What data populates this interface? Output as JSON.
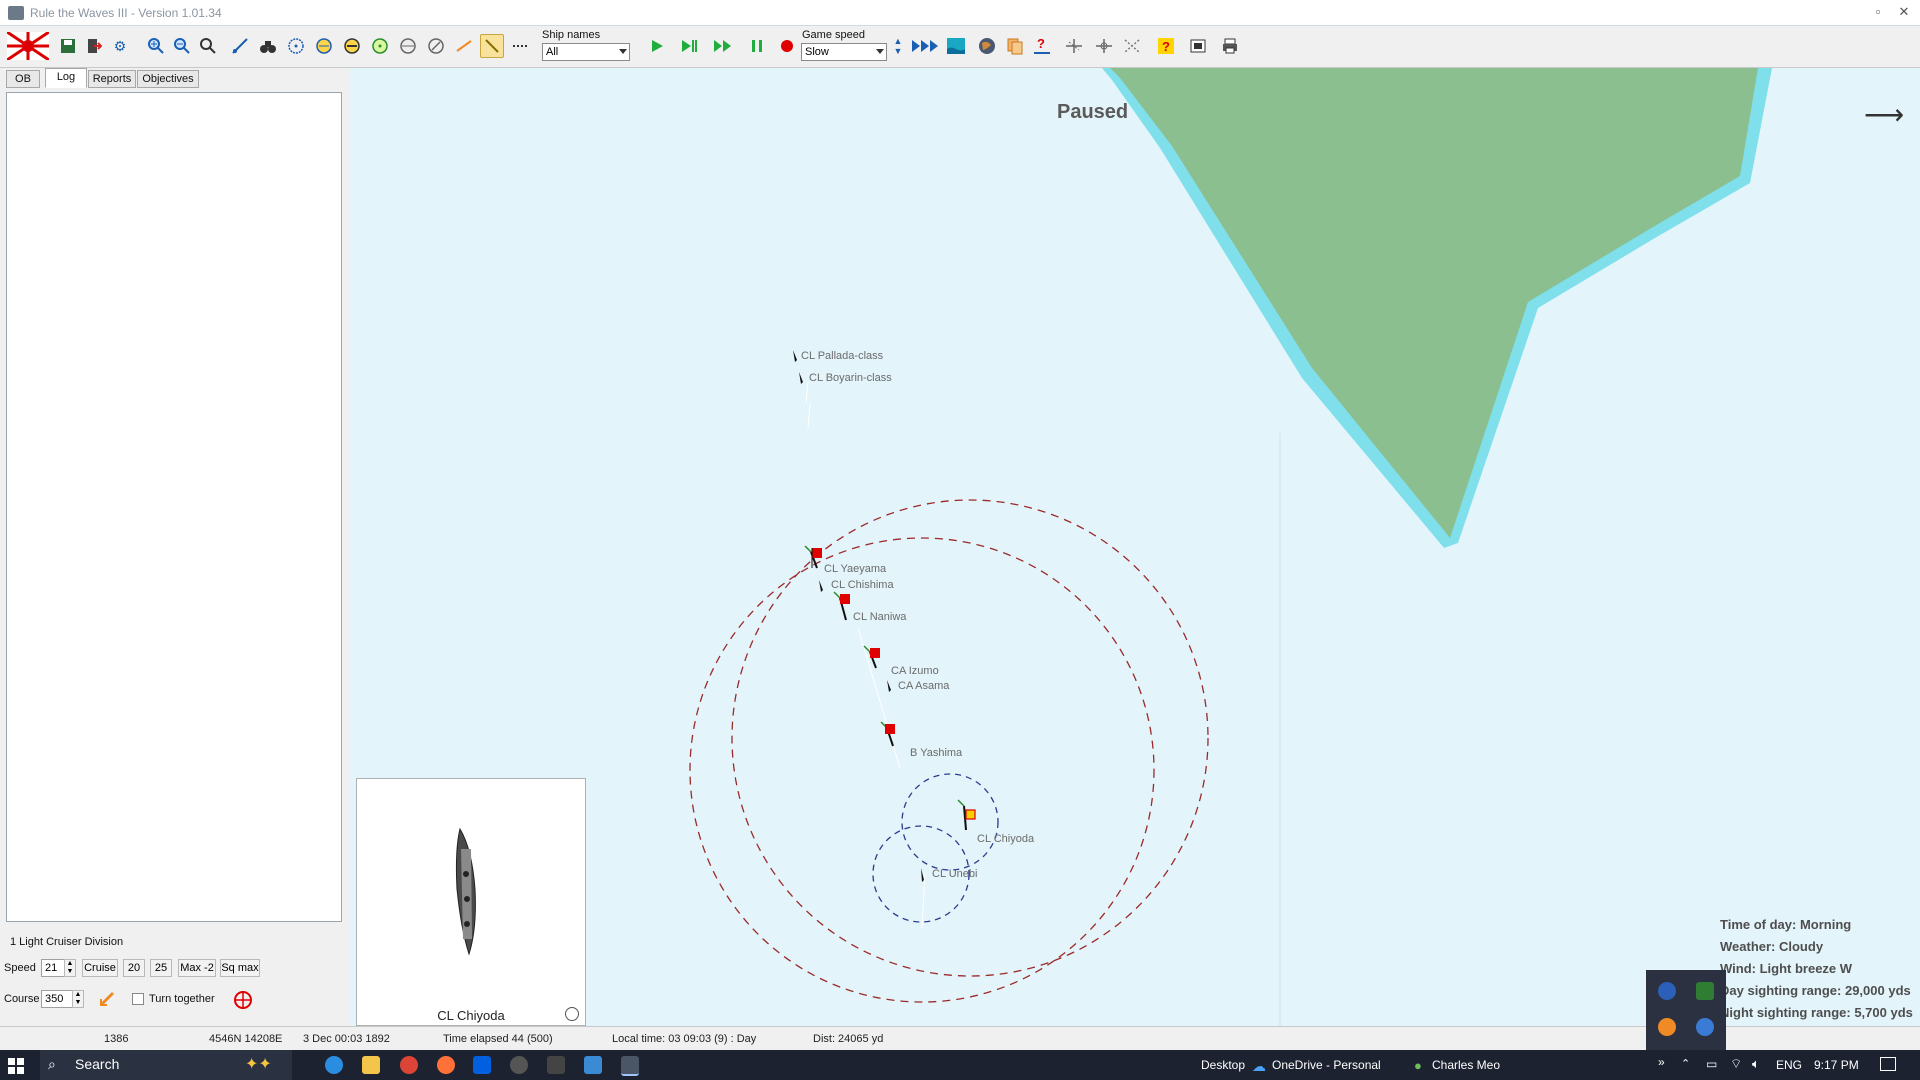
{
  "window": {
    "title": "Rule the Waves III - Version 1.01.34",
    "restore_glyph": "▫",
    "close_glyph": "✕"
  },
  "toolbar": {
    "ship_names_label": "Ship names",
    "ship_names_value": "All",
    "game_speed_label": "Game speed",
    "game_speed_value": "Slow",
    "icons": [
      "japan-flag-icon",
      "save-icon",
      "exit-icon",
      "settings-gear-icon",
      "zoom-in-icon",
      "zoom-out-icon",
      "zoom-fit-icon",
      "measure-icon",
      "binoculars-icon",
      "range-circle-icon",
      "gun-range-icon",
      "torpedo-range-icon",
      "aircraft-range-icon",
      "compass-icon",
      "navigate-icon",
      "track-icon",
      "line-style-icon"
    ]
  },
  "tabs": [
    "OB",
    "Log",
    "Reports",
    "Objectives"
  ],
  "division": {
    "name": "1 Light Cruiser Division",
    "speed_label": "Speed",
    "speed_value": "21",
    "cruise_label": "Cruise",
    "v20": "20",
    "v25": "25",
    "max_label": "Max -2",
    "sqmax_label": "Sq max",
    "course_label": "Course",
    "course_value": "350",
    "turn_together_label": "Turn together"
  },
  "map": {
    "paused_label": "Paused",
    "arrow_glyph": "⟶",
    "ships": [
      {
        "name": "CL Pallada-class"
      },
      {
        "name": "CL Boyarin-class"
      },
      {
        "name": "CL Yaeyama"
      },
      {
        "name": "CL Chishima"
      },
      {
        "name": "CL Naniwa"
      },
      {
        "name": "CA Izumo"
      },
      {
        "name": "CA Asama"
      },
      {
        "name": "B Yashima"
      },
      {
        "name": "CL Chiyoda"
      },
      {
        "name": "CL Unebi"
      }
    ],
    "info": {
      "time_of_day": "Time of day: Morning",
      "weather": "Weather: Cloudy",
      "wind": "Wind: Light breeze  W",
      "day_sighting": "Day sighting range: 29,000 yds",
      "night_sighting": "Night sighting range: 5,700 yds"
    },
    "colors": {
      "sea": "#e3f4fa",
      "land": "#8bbf8f",
      "coast": "#7fe0ec",
      "enemy_flag": "#e00000",
      "selected_flag": "#f5d000",
      "range_red": "#9b2a2a",
      "range_blue": "#2a3b8f"
    }
  },
  "selected_ship": {
    "name": "CL Chiyoda"
  },
  "statusbar": {
    "a": "1386",
    "coords": "4546N 14208E",
    "date": "3 Dec 00:03 1892",
    "elapsed": "Time elapsed 44 (500)",
    "local": "Local time: 03 09:03 (9) : Day",
    "dist": "Dist: 24065 yd"
  },
  "taskbar": {
    "search": "Search",
    "desktop": "Desktop",
    "onedrive": "OneDrive - Personal",
    "user": "Charles Meo",
    "lang": "ENG",
    "time": "9:17 PM",
    "overflow_glyph": "»"
  }
}
